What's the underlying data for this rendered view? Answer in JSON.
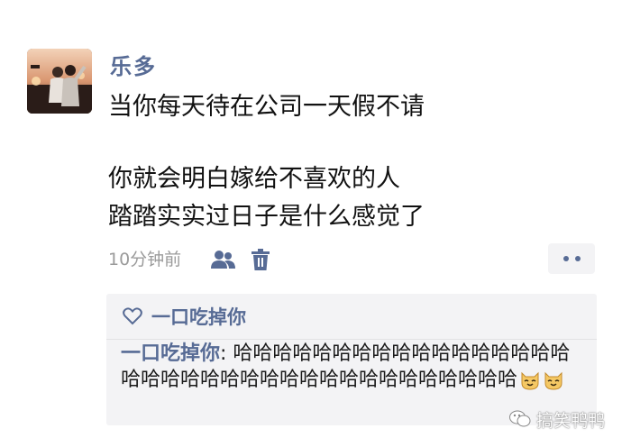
{
  "post": {
    "author": "乐多",
    "lines": [
      "当你每天待在公司一天假不请",
      "你就会明白嫁给不喜欢的人",
      "踏踏实实过日子是什么感觉了"
    ],
    "time": "10分钟前"
  },
  "icons": {
    "friends": "friends-visibility-icon",
    "delete": "trash-icon",
    "more": "more-dots-icon",
    "like": "heart-outline-icon",
    "emoji": "cat-face-emoji-icon",
    "watermark": "wechat-icon"
  },
  "likes": {
    "names": [
      "一口吃掉你"
    ]
  },
  "comments": [
    {
      "author": "一口吃掉你",
      "separator": ": ",
      "text": "哈哈哈哈哈哈哈哈哈哈哈哈哈哈哈哈哈哈哈哈哈哈哈哈哈哈哈哈哈哈哈哈哈哈哈哈哈"
    }
  ],
  "watermark": {
    "text": "搞笑鸭鸭"
  },
  "colors": {
    "link": "#576b95",
    "panel": "#f3f3f5",
    "meta": "#9b9b9b"
  }
}
